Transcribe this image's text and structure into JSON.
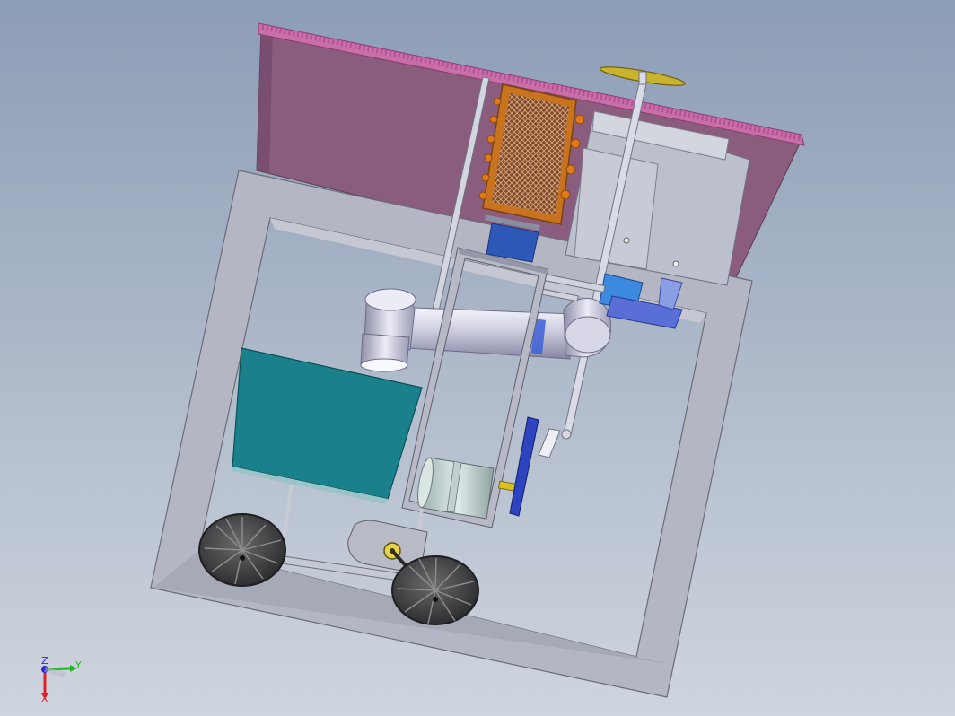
{
  "viewport": {
    "background_top": "#8c9db6",
    "background_bottom": "#cfd5de"
  },
  "colors": {
    "frame": "#b4b7c3",
    "hopper": "#8a5c7e",
    "hopper_rim": "#c86fa8",
    "water_tank": "#19808c",
    "filter_frame": "#c8731e",
    "pipe": "#c6c6dc",
    "accent_blue": "#3c60d8",
    "axis_x": "#e0202a",
    "axis_y": "#26b526",
    "axis_z": "#2a2ad0"
  },
  "triad": {
    "x_label": "X",
    "y_label": "Y",
    "z_label": "Z"
  }
}
